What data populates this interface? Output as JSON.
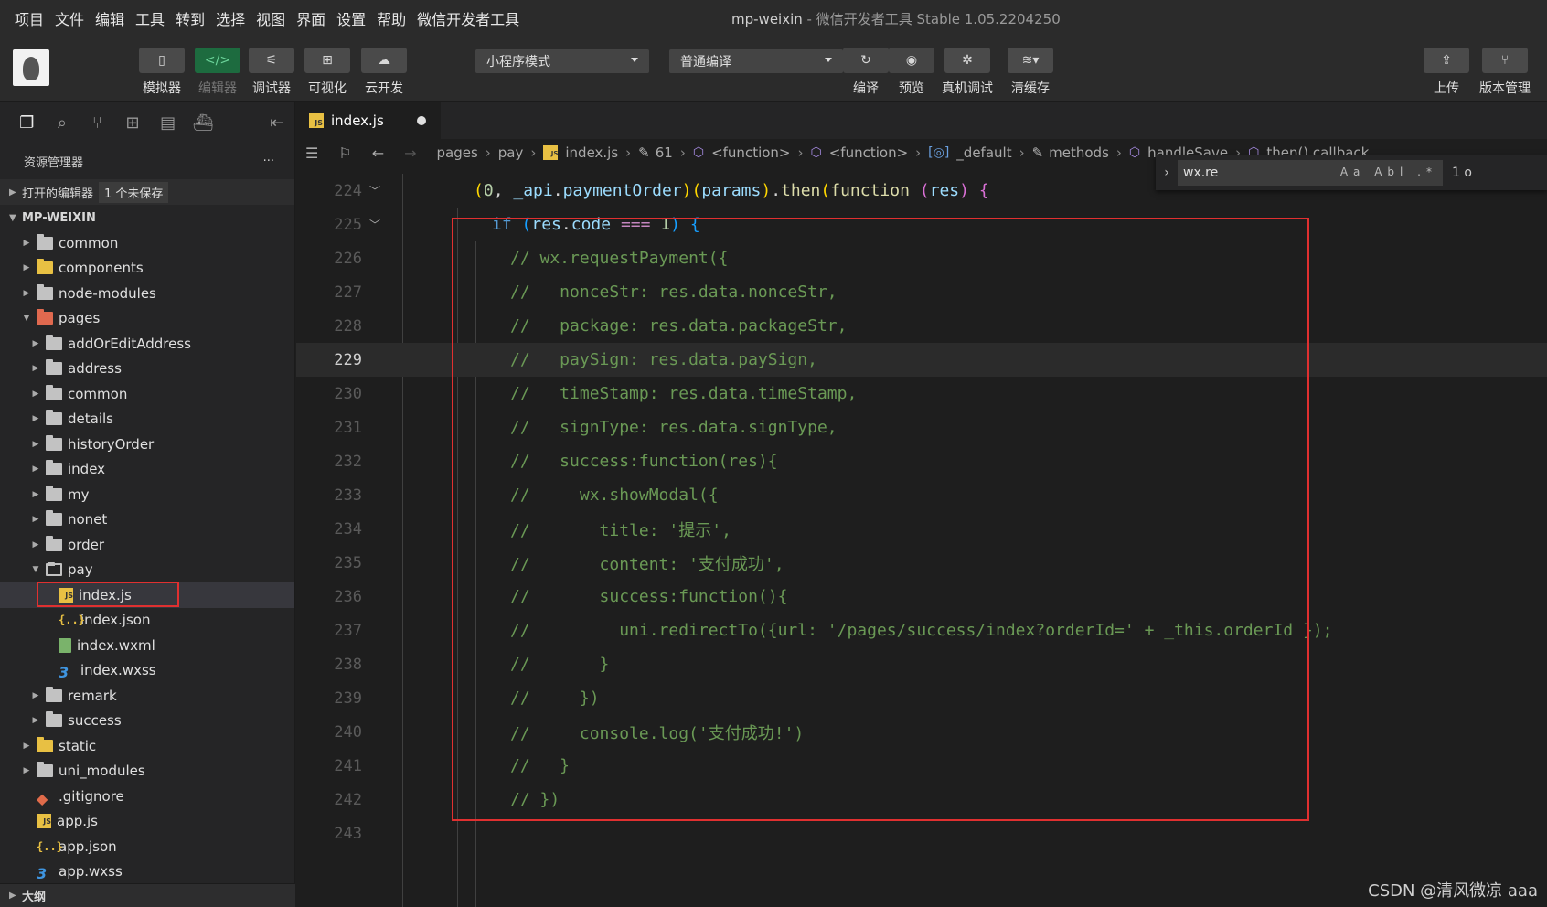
{
  "menu": [
    "项目",
    "文件",
    "编辑",
    "工具",
    "转到",
    "选择",
    "视图",
    "界面",
    "设置",
    "帮助",
    "微信开发者工具"
  ],
  "window_title": {
    "project": "mp-weixin",
    "rest": " - 微信开发者工具 Stable 1.05.2204250"
  },
  "toolbar": {
    "simulator": "模拟器",
    "editor": "编辑器",
    "debugger": "调试器",
    "visual": "可视化",
    "cloud": "云开发",
    "mode_select": "小程序模式",
    "compile_select": "普通编译",
    "compile": "编译",
    "preview": "预览",
    "real_debug": "真机调试",
    "clear_cache": "清缓存",
    "upload": "上传",
    "version": "版本管理"
  },
  "sidebar": {
    "explorer_title": "资源管理器",
    "more": "···",
    "open_editors": "打开的编辑器",
    "unsaved_badge": "1 个未保存",
    "root": "MP-WEIXIN",
    "outline": "大纲",
    "tree": [
      {
        "label": "common"
      },
      {
        "label": "components"
      },
      {
        "label": "node-modules"
      },
      {
        "label": "pages"
      },
      {
        "label": "addOrEditAddress"
      },
      {
        "label": "address"
      },
      {
        "label": "common"
      },
      {
        "label": "details"
      },
      {
        "label": "historyOrder"
      },
      {
        "label": "index"
      },
      {
        "label": "my"
      },
      {
        "label": "nonet"
      },
      {
        "label": "order"
      },
      {
        "label": "pay"
      },
      {
        "label": "index.js"
      },
      {
        "label": "index.json"
      },
      {
        "label": "index.wxml"
      },
      {
        "label": "index.wxss"
      },
      {
        "label": "remark"
      },
      {
        "label": "success"
      },
      {
        "label": "static"
      },
      {
        "label": "uni_modules"
      },
      {
        "label": ".gitignore"
      },
      {
        "label": "app.js"
      },
      {
        "label": "app.json"
      },
      {
        "label": "app.wxss"
      }
    ]
  },
  "editor": {
    "tab": "index.js",
    "breadcrumb": [
      "pages",
      "pay",
      "index.js",
      "61",
      "<function>",
      "<function>",
      "_default",
      "methods",
      "handleSave",
      "then() callback"
    ],
    "find_value": "wx.re",
    "find_opts": "Aa Abl .*",
    "find_count": "1 o",
    "current_line": "229",
    "lines": [
      {
        "n": "224",
        "t": "(0, _api.paymentOrder)(params).then(function (res) {"
      },
      {
        "n": "225",
        "t": "if (res.code === 1) {"
      },
      {
        "n": "226",
        "t": "// wx.requestPayment({"
      },
      {
        "n": "227",
        "t": "//   nonceStr: res.data.nonceStr,"
      },
      {
        "n": "228",
        "t": "//   package: res.data.packageStr,"
      },
      {
        "n": "229",
        "t": "//   paySign: res.data.paySign,"
      },
      {
        "n": "230",
        "t": "//   timeStamp: res.data.timeStamp,"
      },
      {
        "n": "231",
        "t": "//   signType: res.data.signType,"
      },
      {
        "n": "232",
        "t": "//   success:function(res){"
      },
      {
        "n": "233",
        "t": "//     wx.showModal({"
      },
      {
        "n": "234",
        "t": "//       title: '提示',"
      },
      {
        "n": "235",
        "t": "//       content: '支付成功',"
      },
      {
        "n": "236",
        "t": "//       success:function(){"
      },
      {
        "n": "237",
        "t": "//         uni.redirectTo({url: '/pages/success/index?orderId=' + _this.orderId });"
      },
      {
        "n": "238",
        "t": "//       }"
      },
      {
        "n": "239",
        "t": "//     })"
      },
      {
        "n": "240",
        "t": "//     console.log('支付成功!')"
      },
      {
        "n": "241",
        "t": "//   }"
      },
      {
        "n": "242",
        "t": "// })"
      },
      {
        "n": "243",
        "t": ""
      }
    ]
  },
  "watermark": "CSDN @清风微凉 aaa",
  "colors": {
    "highlight_box": "#e03030",
    "comment": "#6a9955",
    "background": "#1e1e1e"
  }
}
